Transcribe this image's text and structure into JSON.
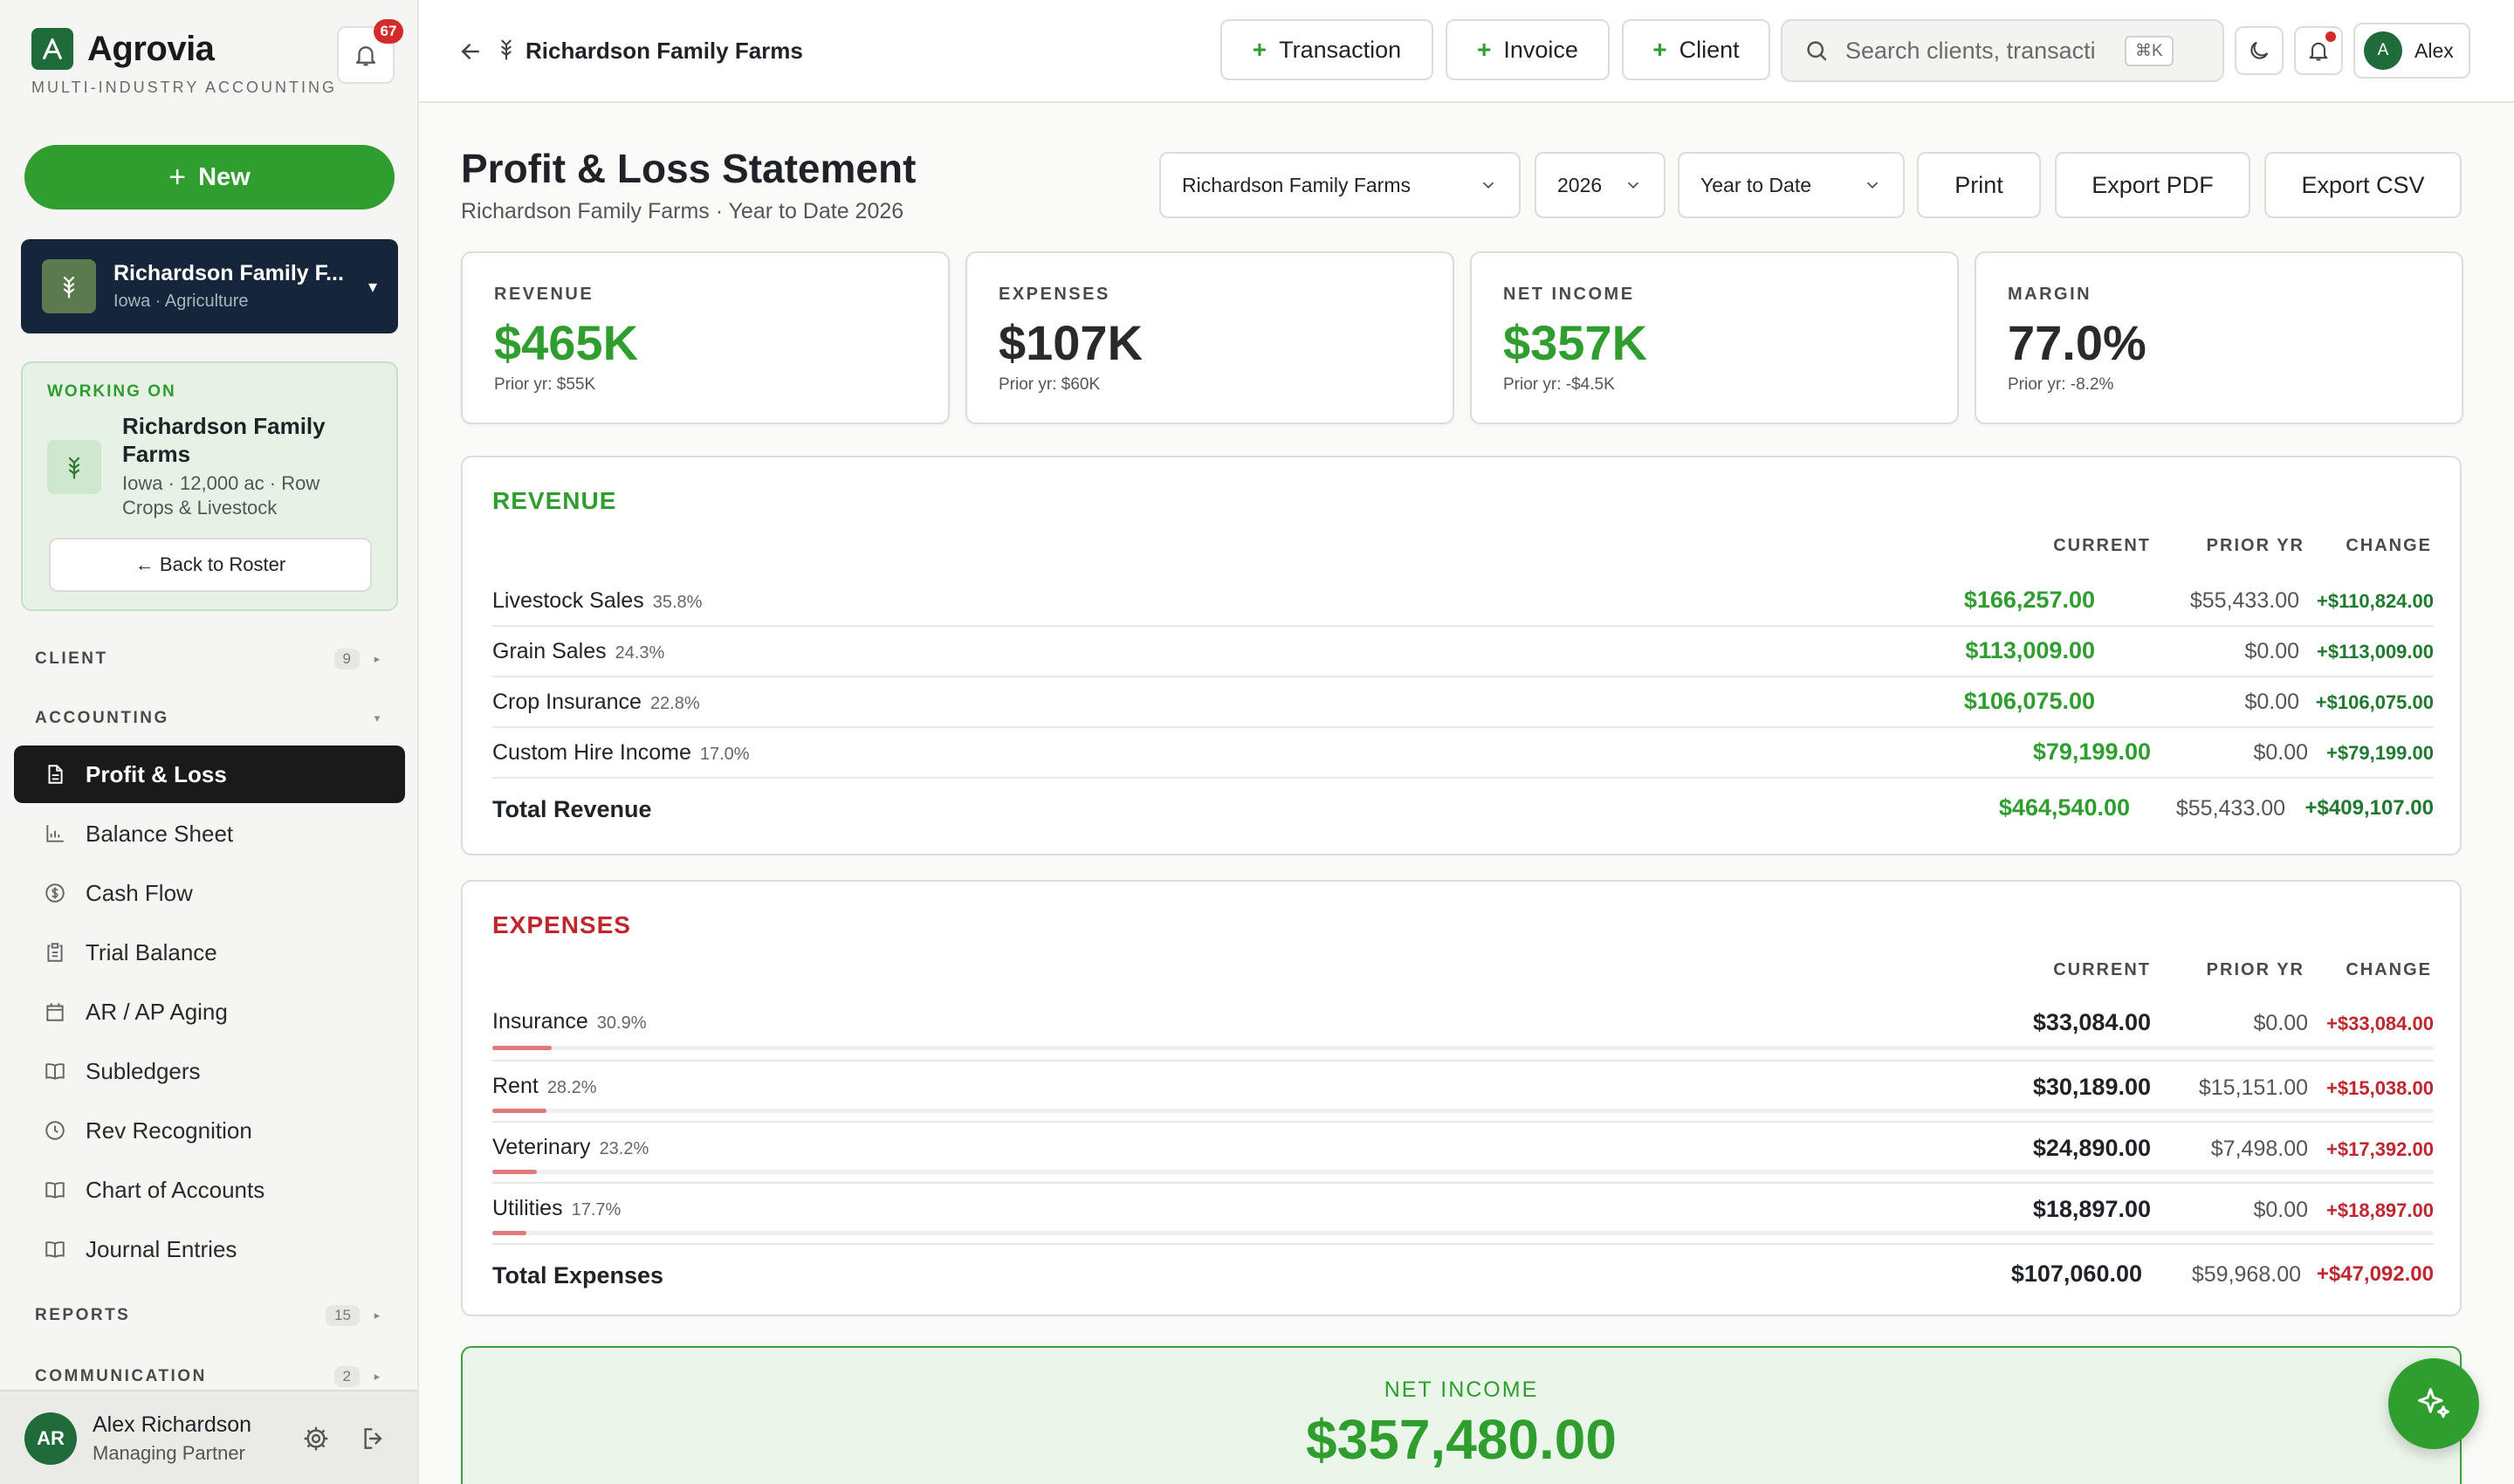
{
  "brand": {
    "name": "Agrovia",
    "tagline": "MULTI-INDUSTRY ACCOUNTING",
    "notifications": "67"
  },
  "sidebar": {
    "new_label": "New",
    "client_switcher": {
      "name": "Richardson Family F...",
      "sub": "Iowa · Agriculture"
    },
    "working_on": {
      "label": "WORKING ON",
      "name": "Richardson Family Farms",
      "details": "Iowa · 12,000 ac · Row Crops & Livestock",
      "back_label": "← Back to Roster"
    },
    "sections": {
      "client": {
        "label": "CLIENT",
        "count": "9"
      },
      "accounting": {
        "label": "ACCOUNTING"
      },
      "reports": {
        "label": "REPORTS",
        "count": "15"
      },
      "communication": {
        "label": "COMMUNICATION",
        "count": "2"
      }
    },
    "items": [
      {
        "label": "Profit & Loss",
        "icon": "document-icon"
      },
      {
        "label": "Balance Sheet",
        "icon": "bar-chart-icon"
      },
      {
        "label": "Cash Flow",
        "icon": "dollar-circle-icon"
      },
      {
        "label": "Trial Balance",
        "icon": "clipboard-icon"
      },
      {
        "label": "AR / AP Aging",
        "icon": "calendar-icon"
      },
      {
        "label": "Subledgers",
        "icon": "book-icon"
      },
      {
        "label": "Rev Recognition",
        "icon": "clock-icon"
      },
      {
        "label": "Chart of Accounts",
        "icon": "book-icon"
      },
      {
        "label": "Journal Entries",
        "icon": "book-icon"
      }
    ],
    "user": {
      "initials": "AR",
      "name": "Alex Richardson",
      "role": "Managing Partner"
    }
  },
  "topbar": {
    "breadcrumb": "Richardson Family Farms",
    "buttons": {
      "transaction": "Transaction",
      "invoice": "Invoice",
      "client": "Client"
    },
    "search_placeholder": "Search clients, transacti",
    "search_shortcut": "⌘K",
    "user": {
      "initial": "A",
      "name": "Alex"
    }
  },
  "page": {
    "title": "Profit & Loss Statement",
    "subtitle": "Richardson Family Farms · Year to Date 2026",
    "filters": {
      "client": "Richardson Family Farms",
      "year": "2026",
      "period": "Year to Date"
    },
    "actions": {
      "print": "Print",
      "export_pdf": "Export PDF",
      "export_csv": "Export CSV"
    }
  },
  "kpis": [
    {
      "label": "REVENUE",
      "value": "$465K",
      "prior": "Prior yr: $55K",
      "color": "#2f9e2f"
    },
    {
      "label": "EXPENSES",
      "value": "$107K",
      "prior": "Prior yr: $60K",
      "color": "#2a2a2a"
    },
    {
      "label": "NET INCOME",
      "value": "$357K",
      "prior": "Prior yr: -$4.5K",
      "color": "#2f9e2f"
    },
    {
      "label": "MARGIN",
      "value": "77.0%",
      "prior": "Prior yr: -8.2%",
      "color": "#2a2a2a"
    }
  ],
  "revenue": {
    "title": "REVENUE",
    "headers": {
      "current": "CURRENT",
      "prior": "PRIOR YR",
      "change": "CHANGE"
    },
    "rows": [
      {
        "name": "Livestock Sales",
        "pct": "35.8%",
        "current": "$166,257.00",
        "prior": "$55,433.00",
        "change": "+$110,824.00"
      },
      {
        "name": "Grain Sales",
        "pct": "24.3%",
        "current": "$113,009.00",
        "prior": "$0.00",
        "change": "+$113,009.00"
      },
      {
        "name": "Crop Insurance",
        "pct": "22.8%",
        "current": "$106,075.00",
        "prior": "$0.00",
        "change": "+$106,075.00"
      },
      {
        "name": "Custom Hire Income",
        "pct": "17.0%",
        "current": "$79,199.00",
        "prior": "$0.00",
        "change": "+$79,199.00"
      }
    ],
    "total": {
      "name": "Total Revenue",
      "current": "$464,540.00",
      "prior": "$55,433.00",
      "change": "+$409,107.00"
    }
  },
  "expenses": {
    "title": "EXPENSES",
    "headers": {
      "current": "CURRENT",
      "prior": "PRIOR YR",
      "change": "CHANGE"
    },
    "rows": [
      {
        "name": "Insurance",
        "pct": "30.9%",
        "share": 0.309,
        "current": "$33,084.00",
        "prior": "$0.00",
        "change": "+$33,084.00"
      },
      {
        "name": "Rent",
        "pct": "28.2%",
        "share": 0.282,
        "current": "$30,189.00",
        "prior": "$15,151.00",
        "change": "+$15,038.00"
      },
      {
        "name": "Veterinary",
        "pct": "23.2%",
        "share": 0.232,
        "current": "$24,890.00",
        "prior": "$7,498.00",
        "change": "+$17,392.00"
      },
      {
        "name": "Utilities",
        "pct": "17.7%",
        "share": 0.177,
        "current": "$18,897.00",
        "prior": "$0.00",
        "change": "+$18,897.00"
      }
    ],
    "total": {
      "name": "Total Expenses",
      "current": "$107,060.00",
      "prior": "$59,968.00",
      "change": "+$47,092.00"
    }
  },
  "net_income": {
    "label": "NET INCOME",
    "value": "$357,480.00"
  },
  "colors": {
    "accent": "#2f9e2f",
    "sidebar_dark": "#16263a",
    "expense_red": "#c0262d",
    "positive_green": "#1f7a2f"
  }
}
